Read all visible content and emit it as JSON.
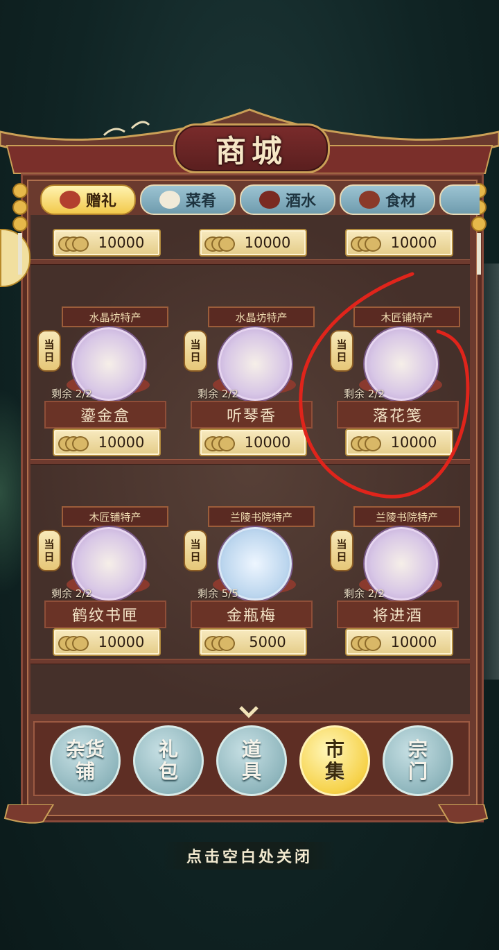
{
  "title": "商城",
  "tabs": [
    {
      "label": "赠礼",
      "active": true,
      "icon": "gift-chest-icon"
    },
    {
      "label": "菜肴",
      "active": false,
      "icon": "dish-icon"
    },
    {
      "label": "酒水",
      "active": false,
      "icon": "wine-jar-icon"
    },
    {
      "label": "食材",
      "active": false,
      "icon": "ingredient-jar-icon"
    }
  ],
  "top_row_prices": [
    "10000",
    "10000",
    "10000"
  ],
  "badge_today": [
    "当",
    "日"
  ],
  "items": [
    {
      "origin": "水晶坊特产",
      "remain": "剩余 2/2",
      "name": "鎏金盒",
      "price": "10000",
      "icon": "gilded-box-icon"
    },
    {
      "origin": "水晶坊特产",
      "remain": "剩余 2/2",
      "name": "听琴香",
      "price": "10000",
      "icon": "incense-burner-icon"
    },
    {
      "origin": "木匠铺特产",
      "remain": "剩余 2/2",
      "name": "落花笺",
      "price": "10000",
      "icon": "letter-paper-icon"
    },
    {
      "origin": "木匠铺特产",
      "remain": "剩余 2/2",
      "name": "鹤纹书匣",
      "price": "10000",
      "icon": "book-case-icon"
    },
    {
      "origin": "兰陵书院特产",
      "remain": "剩余 5/5",
      "name": "金瓶梅",
      "price": "5000",
      "icon": "book-icon"
    },
    {
      "origin": "兰陵书院特产",
      "remain": "剩余 2/2",
      "name": "将进酒",
      "price": "10000",
      "icon": "scroll-poem-icon"
    }
  ],
  "nav": [
    {
      "line1": "杂货",
      "line2": "铺",
      "active": false
    },
    {
      "line1": "礼",
      "line2": "包",
      "active": false
    },
    {
      "line1": "道",
      "line2": "具",
      "active": false
    },
    {
      "line1": "市",
      "line2": "集",
      "active": true
    },
    {
      "line1": "宗",
      "line2": "门",
      "active": false
    }
  ],
  "close_hint": "点击空白处关闭",
  "colors": {
    "annotation_red": "#e0241b",
    "gold": "#caa057",
    "active_tab": "#f2c94c"
  }
}
